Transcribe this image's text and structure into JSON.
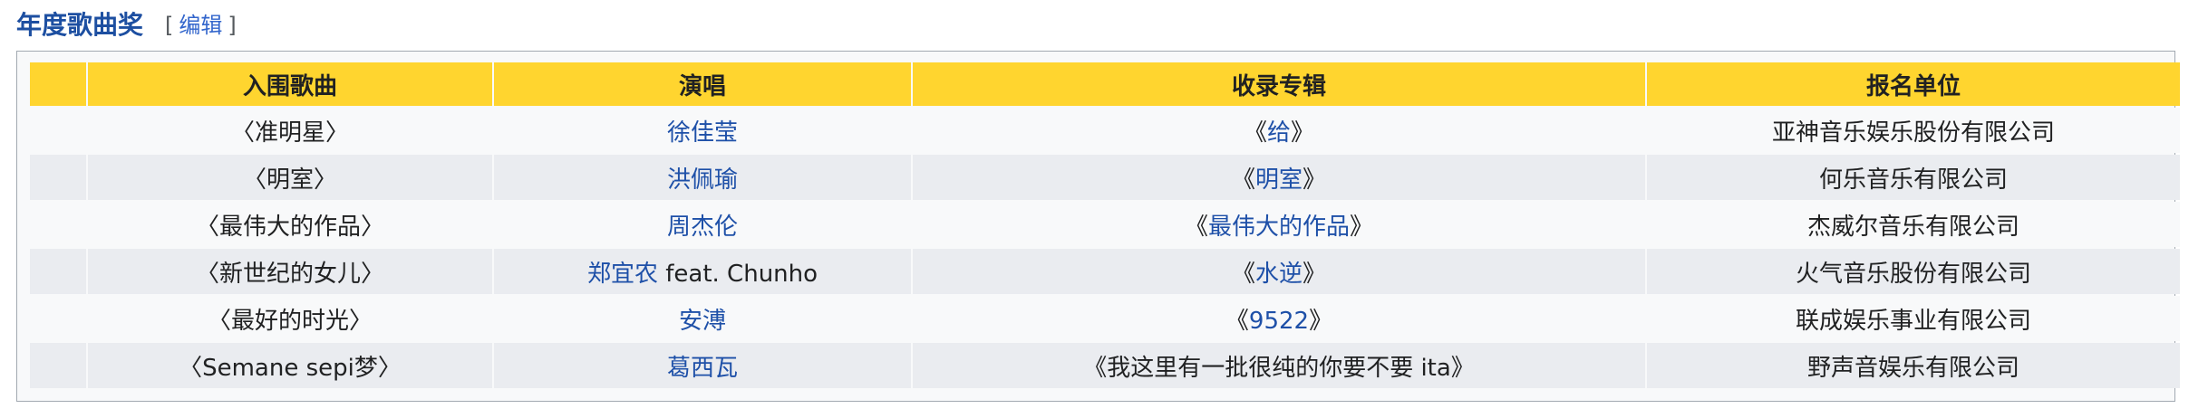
{
  "section": {
    "title": "年度歌曲奖",
    "edit_open": "[",
    "edit_label": "编辑",
    "edit_close": "]"
  },
  "table": {
    "headers": [
      "",
      "入围歌曲",
      "演唱",
      "收录专辑",
      "报名单位"
    ],
    "rows": [
      {
        "song": "〈准明星〉",
        "artist": "徐佳莹",
        "artist_suffix": "",
        "album_open": "《",
        "album": "给",
        "album_close": "》",
        "company": "亚神音乐娱乐股份有限公司"
      },
      {
        "song": "〈明室〉",
        "artist": "洪佩瑜",
        "artist_suffix": "",
        "album_open": "《",
        "album": "明室",
        "album_close": "》",
        "company": "何乐音乐有限公司"
      },
      {
        "song": "〈最伟大的作品〉",
        "artist": "周杰伦",
        "artist_suffix": "",
        "album_open": "《",
        "album": "最伟大的作品",
        "album_close": "》",
        "company": "杰威尔音乐有限公司"
      },
      {
        "song": "〈新世纪的女儿〉",
        "artist": "郑宜农",
        "artist_suffix": " feat. Chunho",
        "album_open": "《",
        "album": "水逆",
        "album_close": "》",
        "company": "火气音乐股份有限公司"
      },
      {
        "song": "〈最好的时光〉",
        "artist": "安溥",
        "artist_suffix": "",
        "album_open": "《",
        "album": "9522",
        "album_close": "》",
        "company": "联成娱乐事业有限公司"
      },
      {
        "song": "〈Semane sepi梦〉",
        "artist": "葛西瓦",
        "artist_suffix": "",
        "album_open": "",
        "album": "《我这里有一批很纯的你要不要 ita》",
        "album_close": "",
        "company": "野声音娱乐有限公司"
      }
    ]
  },
  "colors": {
    "header_bg": "#ffd52f",
    "link": "#1e50a8",
    "title": "#1d4fa1",
    "row_odd": "#f8f9fa",
    "row_even": "#eaecf0"
  }
}
